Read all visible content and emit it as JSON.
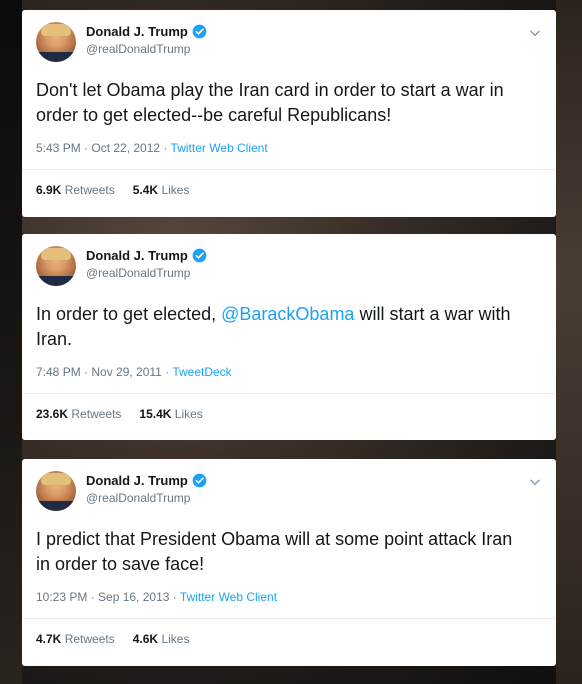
{
  "tweets": [
    {
      "author_name": "Donald J. Trump",
      "author_handle": "@realDonaldTrump",
      "text_before": "Don't let Obama play the Iran card in order to start a war in order to get elected--be careful Republicans!",
      "mention": "",
      "text_after": "",
      "time": "5:43 PM · Oct 22, 2012",
      "sep": " · ",
      "source": "Twitter Web Client",
      "retweets_count": "6.9K",
      "retweets_label": "Retweets",
      "likes_count": "5.4K",
      "likes_label": "Likes"
    },
    {
      "author_name": "Donald J. Trump",
      "author_handle": "@realDonaldTrump",
      "text_before": "In order to get elected, ",
      "mention": "@BarackObama",
      "text_after": " will start a war with Iran.",
      "time": "7:48 PM · Nov 29, 2011",
      "sep": " · ",
      "source": "TweetDeck",
      "retweets_count": "23.6K",
      "retweets_label": "Retweets",
      "likes_count": "15.4K",
      "likes_label": "Likes"
    },
    {
      "author_name": "Donald J. Trump",
      "author_handle": "@realDonaldTrump",
      "text_before": "I predict that President Obama will at some point attack Iran in order to save face!",
      "mention": "",
      "text_after": "",
      "time": "10:23 PM · Sep 16, 2013",
      "sep": " · ",
      "source": "Twitter Web Client",
      "retweets_count": "4.7K",
      "retweets_label": "Retweets",
      "likes_count": "4.6K",
      "likes_label": "Likes"
    }
  ],
  "colors": {
    "link": "#1da1f2",
    "muted": "#657786",
    "text": "#14171a"
  },
  "icons": {
    "verified": "verified-badge-icon",
    "menu": "chevron-down-icon"
  }
}
